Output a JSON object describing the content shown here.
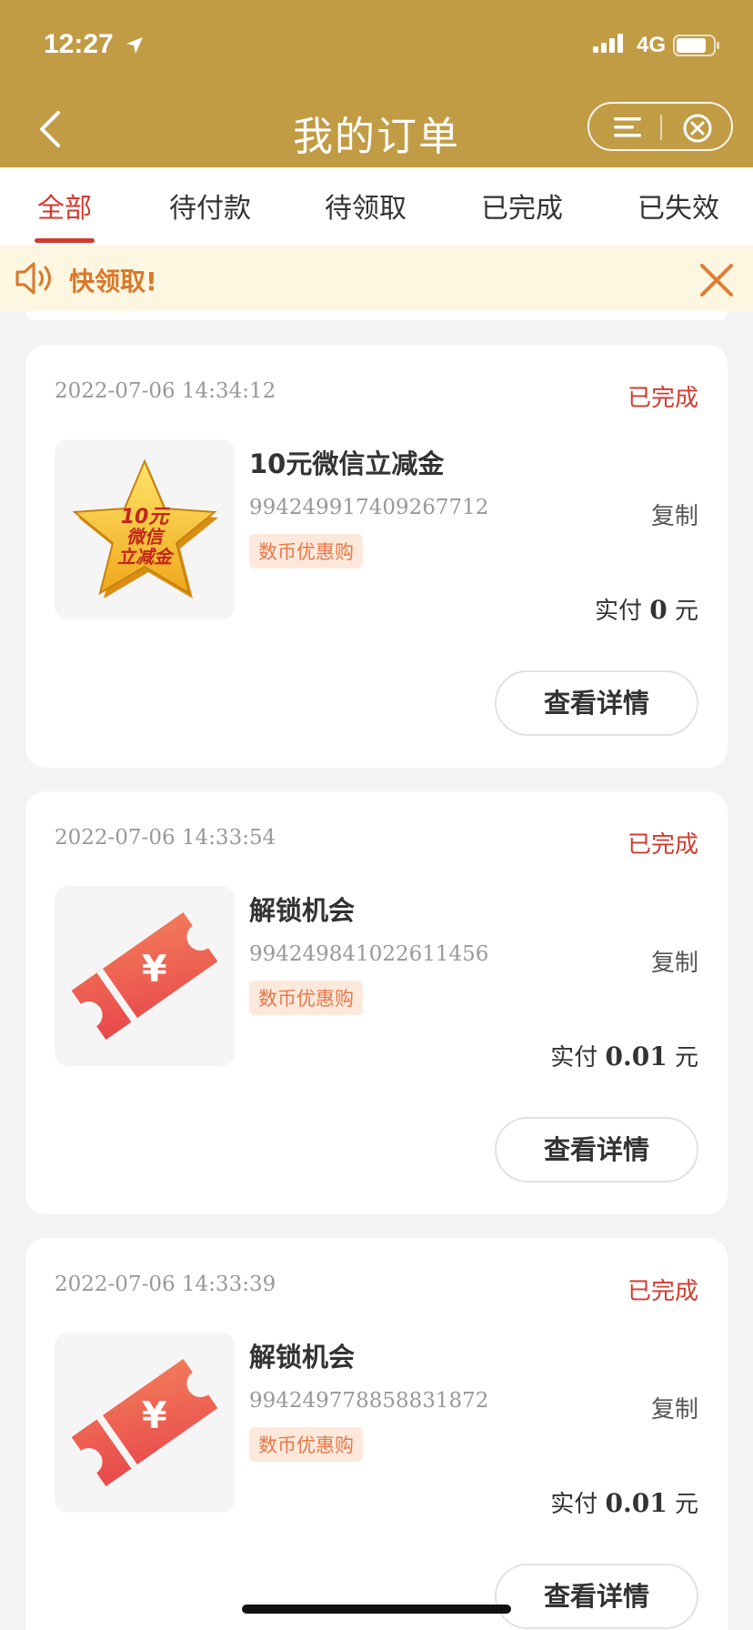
{
  "status_bar": {
    "time": "12:27",
    "network": "4G",
    "icons": [
      "location-arrow-icon",
      "signal-icon",
      "battery-icon"
    ]
  },
  "nav": {
    "title": "我的订单",
    "icons": [
      "back-icon",
      "menu-icon",
      "close-circle-icon"
    ]
  },
  "tabs": [
    {
      "label": "全部",
      "active": true
    },
    {
      "label": "待付款",
      "active": false
    },
    {
      "label": "待领取",
      "active": false
    },
    {
      "label": "已完成",
      "active": false
    },
    {
      "label": "已失效",
      "active": false
    }
  ],
  "notice": {
    "text": "快领取!",
    "icons": [
      "speaker-icon",
      "close-icon"
    ]
  },
  "orders": [
    {
      "date": "2022-07-06 14:34:12",
      "status": "已完成",
      "title": "10元微信立减金",
      "order_no": "994249917409267712",
      "tag": "数币优惠购",
      "copy_label": "复制",
      "paid_label": "实付",
      "paid_amount": "0",
      "paid_unit": "元",
      "detail_label": "查看详情",
      "image": {
        "type": "star",
        "text_lines": [
          "10元",
          "微信",
          "立减金"
        ]
      }
    },
    {
      "date": "2022-07-06 14:33:54",
      "status": "已完成",
      "title": "解锁机会",
      "order_no": "994249841022611456",
      "tag": "数币优惠购",
      "copy_label": "复制",
      "paid_label": "实付",
      "paid_amount": "0.01",
      "paid_unit": "元",
      "detail_label": "查看详情",
      "image": {
        "type": "ticket",
        "symbol": "¥"
      }
    },
    {
      "date": "2022-07-06 14:33:39",
      "status": "已完成",
      "title": "解锁机会",
      "order_no": "994249778858831872",
      "tag": "数币优惠购",
      "copy_label": "复制",
      "paid_label": "实付",
      "paid_amount": "0.01",
      "paid_unit": "元",
      "detail_label": "查看详情",
      "image": {
        "type": "ticket",
        "symbol": "¥"
      }
    }
  ],
  "colors": {
    "header": "#c19c45",
    "accent": "#d23b2f",
    "notice_bg": "#fdf6e1",
    "notice_text": "#d9782a",
    "tag_bg": "#fde9dc",
    "tag_text": "#e6784a"
  }
}
